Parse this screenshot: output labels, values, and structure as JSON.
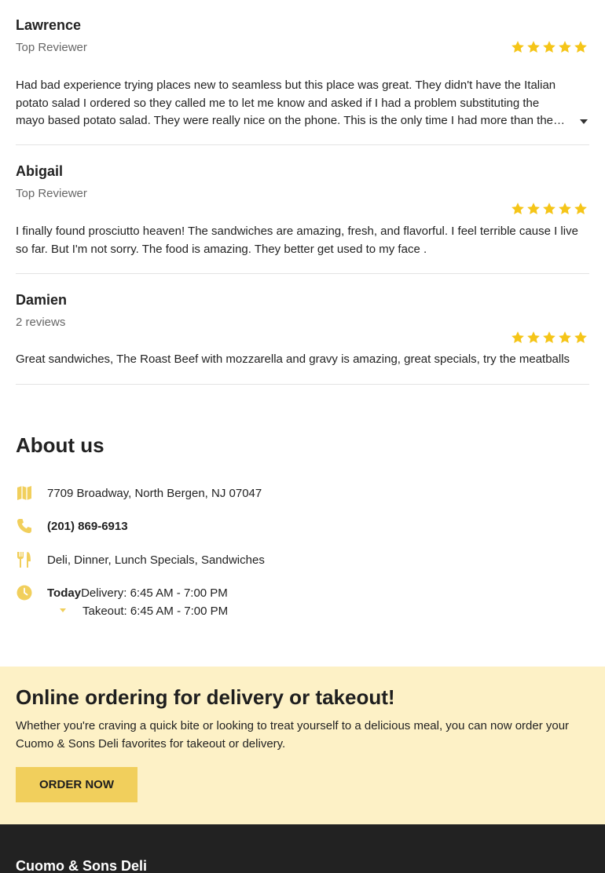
{
  "reviews": [
    {
      "name": "Lawrence",
      "meta": "Top Reviewer",
      "rating": 5,
      "text": "Had bad experience trying places new to seamless but this place was great. They didn't have the Italian potato salad I ordered so they called me to let me know and asked if I had a problem substituting the mayo based potato salad. They were really nice on the phone. This is the only time I had more than the initial order."
    },
    {
      "name": "Abigail",
      "meta": "Top Reviewer",
      "rating": 5,
      "text": "I finally found prosciutto heaven! The sandwiches are amazing, fresh, and flavorful. I feel terrible cause I live so far. But I'm not sorry. The food is amazing. They better get used to my face ."
    },
    {
      "name": "Damien",
      "meta": "2 reviews",
      "rating": 5,
      "text": "Great sandwiches, The Roast Beef with mozzarella and gravy is amazing, great specials, try the meatballs"
    }
  ],
  "about": {
    "title": "About us",
    "address": "7709 Broadway, North Bergen, NJ 07047",
    "phone": "(201) 869-6913",
    "cuisines": "Deli, Dinner, Lunch Specials, Sandwiches",
    "hours": {
      "today_label": "Today",
      "delivery": "Delivery: 6:45 AM - 7:00 PM",
      "takeout": "Takeout: 6:45 AM - 7:00 PM"
    },
    "icons": {
      "address": "map-icon",
      "phone": "phone-icon",
      "cuisines": "utensils-icon",
      "hours": "clock-icon"
    }
  },
  "order": {
    "title": "Online ordering for delivery or takeout!",
    "description": "Whether you're craving a quick bite or looking to treat yourself to a delicious meal, you can now order your Cuomo & Sons Deli favorites for takeout or delivery.",
    "button_label": "ORDER NOW"
  },
  "footer": {
    "brand": "Cuomo & Sons Deli"
  },
  "colors": {
    "accent": "#f1cf5c",
    "star": "#f5c518",
    "band_bg": "#fdf1c6",
    "footer_bg": "#222222"
  }
}
